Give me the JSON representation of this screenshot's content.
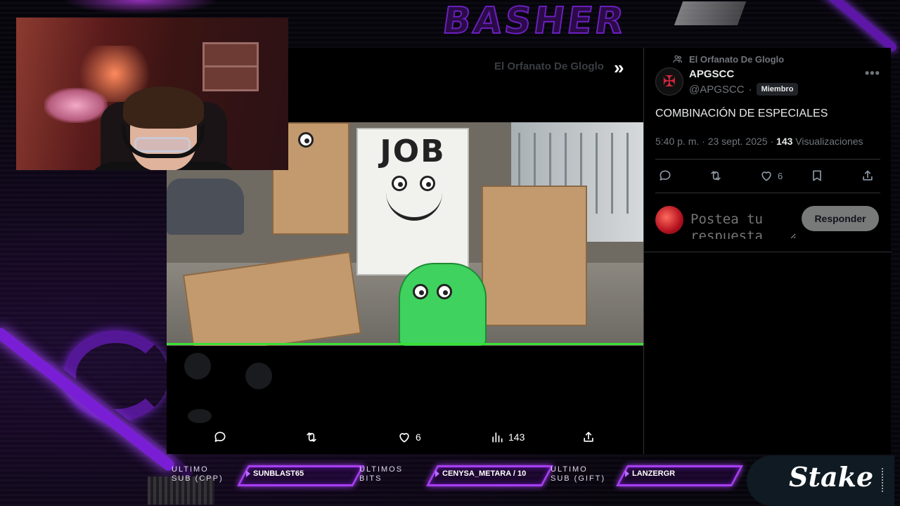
{
  "overlay": {
    "brand_watermark": "BASHER",
    "colors": {
      "neon_purple": "#a63ff0",
      "accent_green": "#39e033",
      "bg": "#07050c"
    }
  },
  "webcam": {
    "description_icon": "streamer-webcam"
  },
  "tweet_panel": {
    "community_top": "El Orfanato De Gloglo",
    "video_progress_percent": 100,
    "actions": {
      "like_count": "6",
      "views_count": "143"
    }
  },
  "sidebar_tweet": {
    "community": "El Orfanato De Gloglo",
    "author_name": "APGSCC",
    "author_handle": "@APGSCC",
    "separator": "·",
    "member_badge": "Miembro",
    "text": "COMBINACIÓN DE ESPECIALES",
    "time": "5:40 p. m.",
    "date": "23 sept. 2025",
    "views_count": "143",
    "views_label": "Visualizaciones",
    "like_count": "6",
    "reply_placeholder": "Postea tu respuesta",
    "reply_button": "Responder"
  },
  "stream_bar": {
    "slot1": {
      "label_line1": "ULTIMO",
      "label_line2": "SUB (CPP)",
      "value": "SUNBLAST65"
    },
    "slot2": {
      "label_line1": "ULTIMOS",
      "label_line2": "BITS",
      "value": "CENYSA_METARA / 10"
    },
    "slot3": {
      "label_line1": "ULTIMO",
      "label_line2": "SUB (GIFT)",
      "value": "LANZERGR"
    },
    "sponsor": "Stake"
  }
}
